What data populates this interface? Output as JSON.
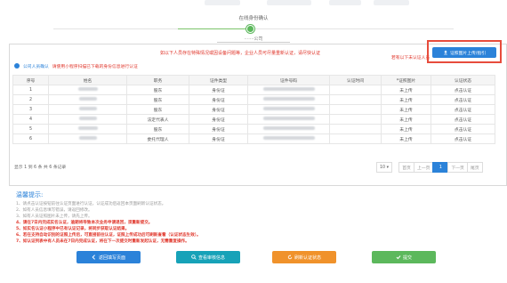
{
  "step": {
    "label": "在线身份确认"
  },
  "company": {
    "name": "·······公司"
  },
  "notice": {
    "main": "如以下人员存在特殊情况或因设备问题等，企业人员可尽量重新认证，请尽快认证",
    "right": "若有以下未认证人员"
  },
  "upload_button": {
    "label": "证照图片上传/指引"
  },
  "legend": {
    "text": "公司人员确认",
    "warn": "请使用小程序扫描已下载的身份信息进行认证"
  },
  "table": {
    "headers": [
      "序号",
      "姓名",
      "职务",
      "证件类型",
      "证件号码",
      "认证时间",
      "*证照图片",
      "认证状态"
    ],
    "rows": [
      {
        "no": "1",
        "role": "股东",
        "id_type": "身份证",
        "photo": "未上传",
        "status": "点击认证"
      },
      {
        "no": "2",
        "role": "股东",
        "id_type": "身份证",
        "photo": "未上传",
        "status": "点击认证"
      },
      {
        "no": "3",
        "role": "股东",
        "id_type": "身份证",
        "photo": "未上传",
        "status": "点击认证"
      },
      {
        "no": "4",
        "role": "法定代表人",
        "id_type": "身份证",
        "photo": "未上传",
        "status": "点击认证"
      },
      {
        "no": "5",
        "role": "股东",
        "id_type": "身份证",
        "photo": "未上传",
        "status": "点击认证"
      },
      {
        "no": "6",
        "role": "委托代理人",
        "id_type": "身份证",
        "photo": "未上传",
        "status": "点击认证"
      }
    ]
  },
  "pager": {
    "info": "显示 1 到 6 条 共 6 条记录",
    "size": "10",
    "first": "首页",
    "prev": "上一页",
    "current": "1",
    "next": "下一页",
    "last": "尾页"
  },
  "tips": {
    "title": "温馨提示:",
    "gray": [
      "1、请点击认证按钮前往认证页面进行认证，认证成功后返回本页面刷新认证状态。",
      "2、如有人员信息填写错误，请返回修改。",
      "3、如有人员证照图片未上传，请先上传。"
    ],
    "red": [
      "4、请在7日内完成实名认证，逾期将导致本次业务申请退回，须重新提交。",
      "5、如实名认证小程序中已有认证记录，将同步获取认证结果。",
      "6、若在支持自动识别的证照上传后，可直接前往认证，证照上传成功后可刷新查看（认证状态生效）。",
      "7、如认证列表中有人员未在7日内完成认证，将在下一次提交时重新发起认证，无需重复操作。"
    ]
  },
  "actions": {
    "back": "返回填写页面",
    "view": "查看审核信息",
    "refresh": "刷新认证状态",
    "submit": "提交"
  },
  "colors": {
    "primary": "#2b82d9",
    "danger": "#e0362b",
    "info": "#17a2b8",
    "warning": "#f0922b",
    "success": "#5cb85c"
  }
}
